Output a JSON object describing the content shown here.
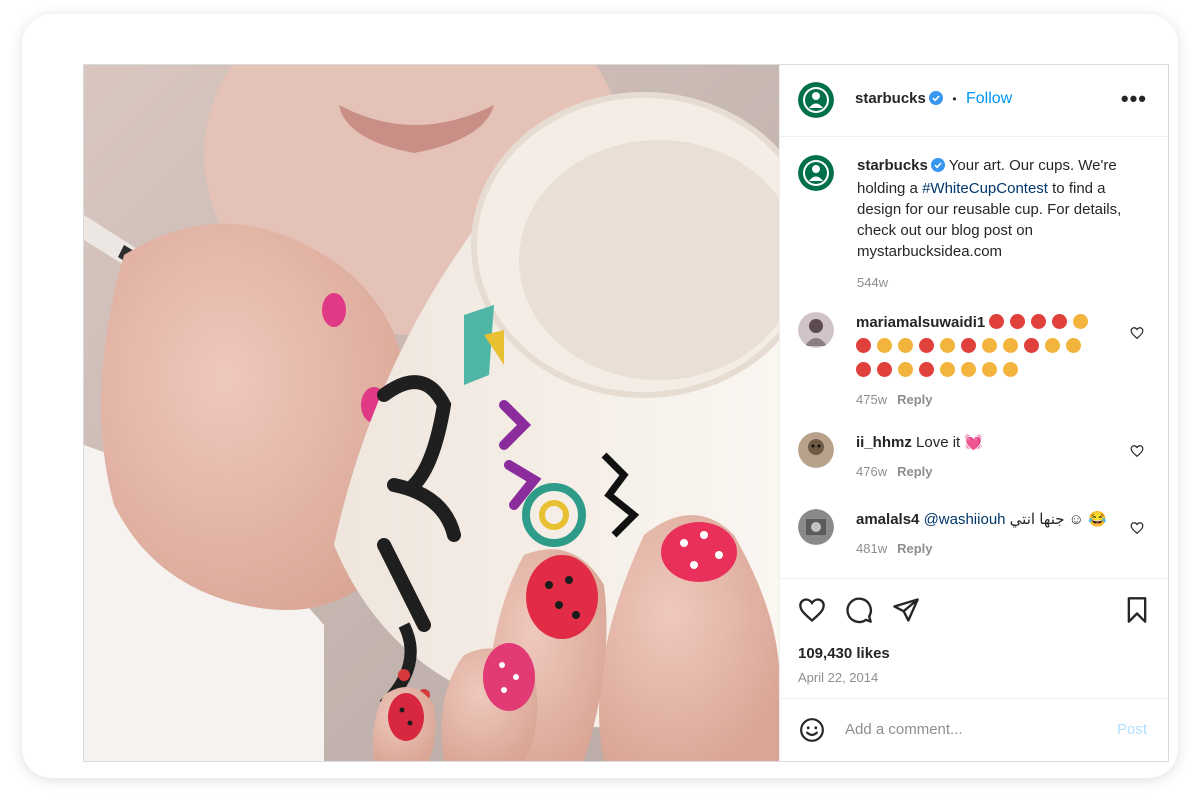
{
  "post": {
    "author": {
      "username": "starbucks",
      "verified": true
    },
    "header": {
      "separator": "•",
      "follow_label": "Follow",
      "more_icon": "more-horizontal-icon",
      "more_label": "•••"
    },
    "caption": {
      "username": "starbucks",
      "text_before": "Your art. Our cups. We're holding a ",
      "hashtag": "#WhiteCupContest",
      "text_after": " to find a design for our reusable cup. For details, check out our blog post on mystarbucksidea.com",
      "age": "544w"
    },
    "comments": [
      {
        "username": "mariamalsuwaidi1",
        "text": "",
        "age": "475w",
        "reply_label": "Reply",
        "emoji_rows": [
          [
            "red",
            "red",
            "red",
            "red",
            "yel"
          ],
          [
            "red",
            "yel",
            "yel",
            "red",
            "yel",
            "red",
            "yel",
            "yel",
            "red",
            "yel",
            "yel"
          ],
          [
            "red",
            "red",
            "yel",
            "red",
            "yel",
            "yel",
            "yel",
            "yel"
          ]
        ]
      },
      {
        "username": "ii_hhmz",
        "text": "Love it 💓",
        "age": "476w",
        "reply_label": "Reply"
      },
      {
        "username": "amalals4",
        "mention": "@washiiouh",
        "text": "جنها انتي ☺ 😂",
        "age": "481w",
        "reply_label": "Reply"
      }
    ],
    "actions": {
      "like_icon": "heart-icon",
      "comment_icon": "comment-icon",
      "share_icon": "send-icon",
      "save_icon": "bookmark-icon"
    },
    "likes": "109,430 likes",
    "date": "April 22, 2014",
    "add_comment": {
      "emoji_icon": "smiley-icon",
      "placeholder": "Add a comment...",
      "post_label": "Post"
    },
    "colors": {
      "accent": "#0095f6",
      "hashtag": "#00376b",
      "muted": "#8e8e8e",
      "post_disabled": "#b2dffc",
      "starbucks_green": "#00704a"
    }
  }
}
